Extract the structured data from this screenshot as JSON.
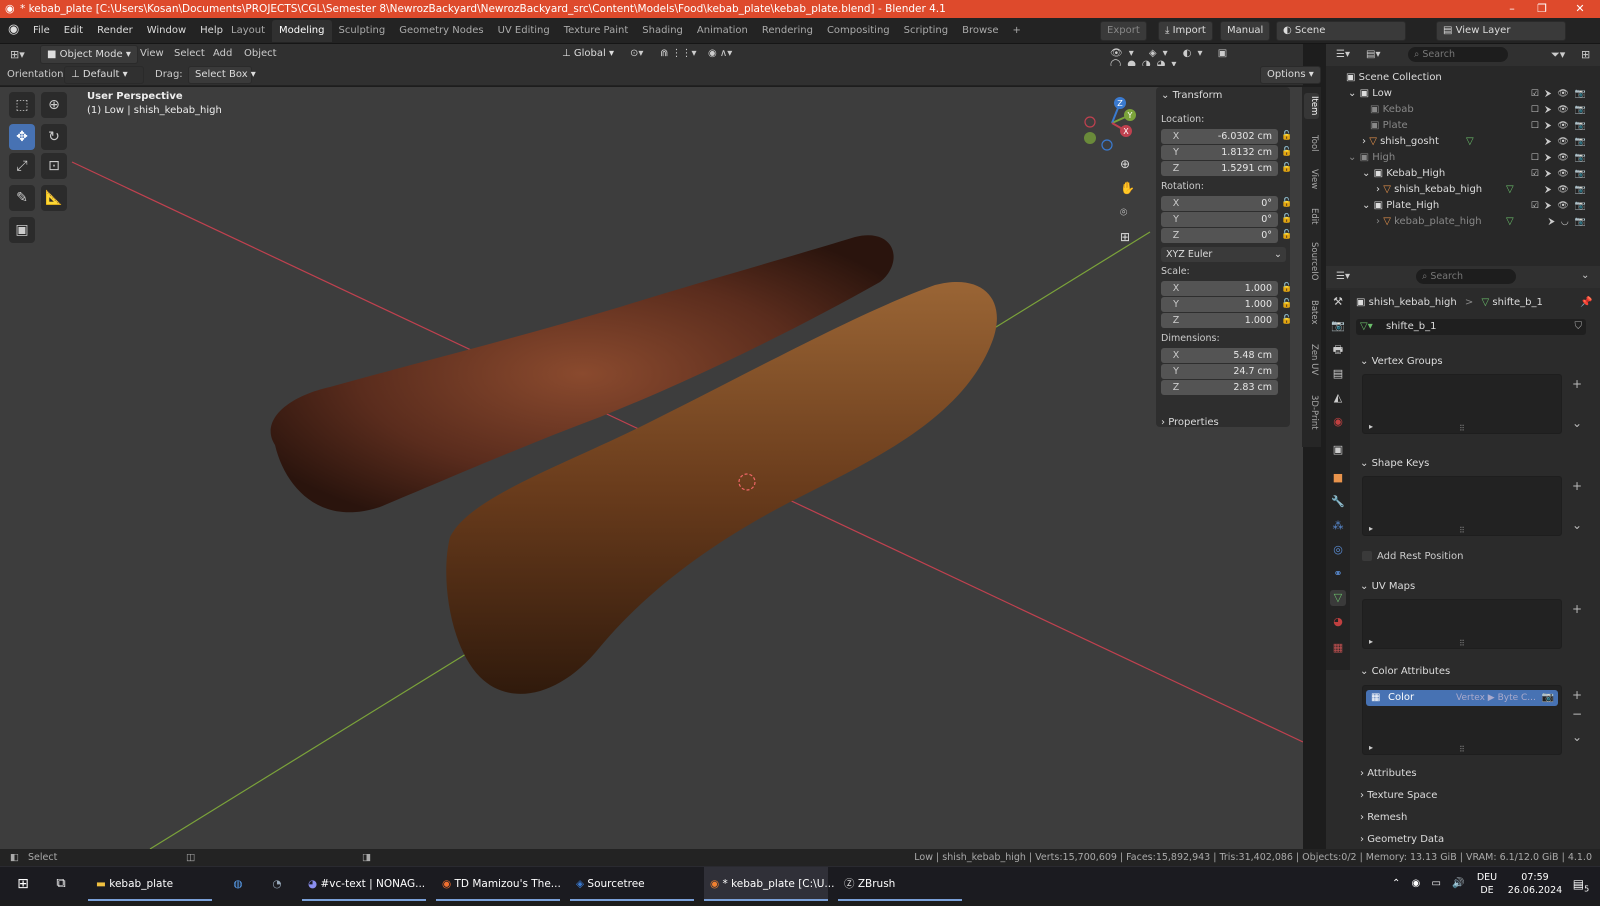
{
  "window": {
    "title": "* kebab_plate [C:\\Users\\Kosan\\Documents\\PROJECTS\\CGL\\Semester 8\\NewrozBackyard\\NewrozBackyard_src\\Content\\Models\\Food\\kebab_plate\\kebab_plate.blend] - Blender 4.1",
    "minimize": "–",
    "maximize": "❐",
    "close": "✕"
  },
  "menu": [
    "File",
    "Edit",
    "Render",
    "Window",
    "Help"
  ],
  "workspaces": [
    "Layout",
    "Modeling",
    "Sculpting",
    "Geometry Nodes",
    "UV Editing",
    "Texture Paint",
    "Shading",
    "Animation",
    "Rendering",
    "Compositing",
    "Scripting",
    "Browse"
  ],
  "active_workspace": "Modeling",
  "workspace_add": "+",
  "topright": {
    "export": "Export",
    "import": "Import",
    "manual": "Manual",
    "scene": "Scene",
    "view_layer": "View Layer"
  },
  "header": {
    "mode": "Object Mode",
    "menus": [
      "View",
      "Select",
      "Add",
      "Object"
    ],
    "transform_orientation": "Global",
    "options": "Options"
  },
  "toolheader": {
    "orientation_label": "Orientation:",
    "orientation_value": "Default",
    "drag_label": "Drag:",
    "drag_value": "Select Box"
  },
  "viewport": {
    "perspective": "User Perspective",
    "object_line": "(1) Low | shish_kebab_high",
    "gizmo": {
      "x": "X",
      "y": "Y",
      "z": "Z"
    }
  },
  "npanel": {
    "title": "Transform",
    "location_label": "Location:",
    "location": [
      {
        "axis": "X",
        "value": "-6.0302 cm"
      },
      {
        "axis": "Y",
        "value": "1.8132 cm"
      },
      {
        "axis": "Z",
        "value": "1.5291 cm"
      }
    ],
    "rotation_label": "Rotation:",
    "rotation": [
      {
        "axis": "X",
        "value": "0°"
      },
      {
        "axis": "Y",
        "value": "0°"
      },
      {
        "axis": "Z",
        "value": "0°"
      }
    ],
    "rotation_mode": "XYZ Euler",
    "scale_label": "Scale:",
    "scale": [
      {
        "axis": "X",
        "value": "1.000"
      },
      {
        "axis": "Y",
        "value": "1.000"
      },
      {
        "axis": "Z",
        "value": "1.000"
      }
    ],
    "dimensions_label": "Dimensions:",
    "dimensions": [
      {
        "axis": "X",
        "value": "5.48 cm"
      },
      {
        "axis": "Y",
        "value": "24.7 cm"
      },
      {
        "axis": "Z",
        "value": "2.83 cm"
      }
    ],
    "properties": "Properties"
  },
  "sidebar_tabs": [
    "Item",
    "Tool",
    "View",
    "Edit",
    "SourceIO",
    "Batex",
    "Zen UV",
    "3D-Print"
  ],
  "outliner": {
    "search_placeholder": "Search",
    "root": "Scene Collection",
    "rows": [
      {
        "label": "Low",
        "indent": 0,
        "type": "collection",
        "dim": false
      },
      {
        "label": "Kebab",
        "indent": 1,
        "type": "collection",
        "dim": true
      },
      {
        "label": "Plate",
        "indent": 1,
        "type": "collection",
        "dim": true
      },
      {
        "label": "shish_gosht",
        "indent": 1,
        "type": "mesh",
        "dim": false
      },
      {
        "label": "High",
        "indent": 0,
        "type": "collection",
        "dim": true
      },
      {
        "label": "Kebab_High",
        "indent": 1,
        "type": "collection",
        "dim": false
      },
      {
        "label": "shish_kebab_high",
        "indent": 2,
        "type": "mesh",
        "dim": false
      },
      {
        "label": "Plate_High",
        "indent": 1,
        "type": "collection",
        "dim": false
      },
      {
        "label": "kebab_plate_high",
        "indent": 2,
        "type": "mesh",
        "dim": true
      }
    ]
  },
  "properties": {
    "search_placeholder": "Search",
    "breadcrumb_object": "shish_kebab_high",
    "breadcrumb_sep": ">",
    "breadcrumb_data": "shifte_b_1",
    "mesh_name": "shifte_b_1",
    "vertex_groups": "Vertex Groups",
    "shape_keys": "Shape Keys",
    "add_rest_position": "Add Rest Position",
    "uv_maps": "UV Maps",
    "color_attributes": "Color Attributes",
    "color_attr_name": "Color",
    "color_attr_type": "Vertex ▶ Byte C...",
    "attributes": "Attributes",
    "texture_space": "Texture Space",
    "remesh": "Remesh",
    "geometry_data": "Geometry Data"
  },
  "statusbar": {
    "left": "Select",
    "stats": "Low | shish_kebab_high | Verts:15,700,609 | Faces:15,892,943 | Tris:31,402,086 | Objects:0/2 | Memory: 13.13 GiB | VRAM: 6.1/12.0 GiB | 4.1.0"
  },
  "taskbar": {
    "items": [
      {
        "label": "kebab_plate",
        "icon": "folder-icon"
      },
      {
        "label": "",
        "icon": "browser-icon"
      },
      {
        "label": "",
        "icon": "steam-icon"
      },
      {
        "label": "#vc-text | NONAG...",
        "icon": "discord-icon"
      },
      {
        "label": "TD Mamizou's The...",
        "icon": "firefox-icon"
      },
      {
        "label": "Sourcetree",
        "icon": "sourcetree-icon"
      },
      {
        "label": "* kebab_plate [C:\\U...",
        "icon": "blender-icon"
      },
      {
        "label": "ZBrush",
        "icon": "zbrush-icon"
      }
    ],
    "lang": "DEU",
    "lang2": "DE",
    "time": "07:59",
    "date": "26.06.2024",
    "notify_count": "5"
  },
  "colors": {
    "accent": "#4772b3",
    "title": "#de4a2c",
    "x_axis": "#c0414f",
    "y_axis": "#7ba33a",
    "z_axis": "#3a7ad0"
  }
}
